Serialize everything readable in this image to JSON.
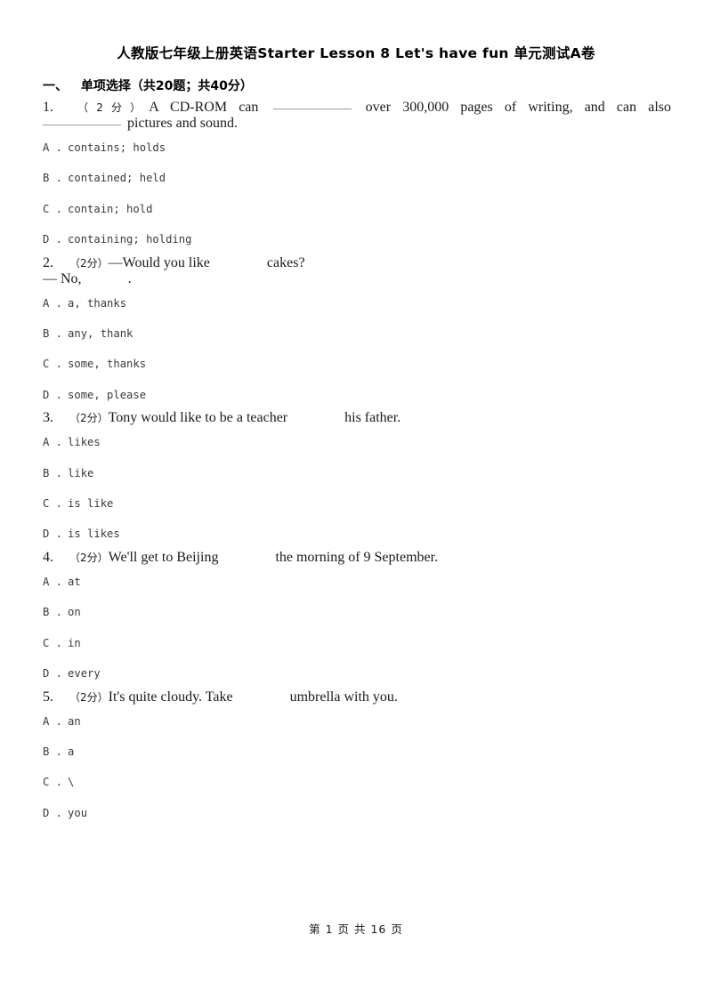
{
  "document": {
    "title_cn_prefix": "人教版七年级上册英语",
    "title_en": "Starter Lesson 8 Let's have fun",
    "title_cn_suffix": "单元测试A卷",
    "full_title": "人教版七年级上册英语Starter Lesson 8 Let's have fun 单元测试A卷"
  },
  "section": {
    "index": "一、",
    "name": "单项选择（共20题；共40分）",
    "question_count": 20,
    "total_points": 40
  },
  "questions": [
    {
      "number": "1.",
      "score": "（2分）",
      "line1_a": "A",
      "line1_b": "CD-ROM",
      "line1_c": "can",
      "line1_d": "over",
      "line1_e": "300,000",
      "line1_f": "pages",
      "line1_g": "of",
      "line1_h": "writing,",
      "line1_i": "and",
      "line1_j": "can",
      "line1_k": "also",
      "line2_tail": "pictures and sound.",
      "options": [
        {
          "letter": "A .",
          "text": "contains; holds"
        },
        {
          "letter": "B .",
          "text": "contained; held"
        },
        {
          "letter": "C .",
          "text": "contain; hold"
        },
        {
          "letter": "D .",
          "text": "containing; holding"
        }
      ]
    },
    {
      "number": "2.",
      "score": "（2分）",
      "stem_before": "—Would you like",
      "stem_after": "cakes?",
      "reply_before": "— No,",
      "reply_after": ".",
      "options": [
        {
          "letter": "A .",
          "text": "a, thanks"
        },
        {
          "letter": "B .",
          "text": "any, thank"
        },
        {
          "letter": "C .",
          "text": "some, thanks"
        },
        {
          "letter": "D .",
          "text": "some, please"
        }
      ]
    },
    {
      "number": "3.",
      "score": "（2分）",
      "stem_before": "Tony would like to be a teacher",
      "stem_after": "his father.",
      "options": [
        {
          "letter": "A .",
          "text": "likes"
        },
        {
          "letter": "B .",
          "text": "like"
        },
        {
          "letter": "C .",
          "text": "is like"
        },
        {
          "letter": "D .",
          "text": "is likes"
        }
      ]
    },
    {
      "number": "4.",
      "score": "（2分）",
      "stem_before": "We'll get to Beijing",
      "stem_after": "the morning of 9 September.",
      "options": [
        {
          "letter": "A .",
          "text": "at"
        },
        {
          "letter": "B .",
          "text": "on"
        },
        {
          "letter": "C .",
          "text": "in"
        },
        {
          "letter": "D .",
          "text": "every"
        }
      ]
    },
    {
      "number": "5.",
      "score": "（2分）",
      "stem_before": "It's quite cloudy. Take",
      "stem_after": "umbrella with you.",
      "options": [
        {
          "letter": "A .",
          "text": "an"
        },
        {
          "letter": "B .",
          "text": "a"
        },
        {
          "letter": "C .",
          "text": "\\"
        },
        {
          "letter": "D .",
          "text": "you"
        }
      ]
    }
  ],
  "footer": {
    "text": "第 1 页 共 16 页",
    "current_page": 1,
    "total_pages": 16
  }
}
